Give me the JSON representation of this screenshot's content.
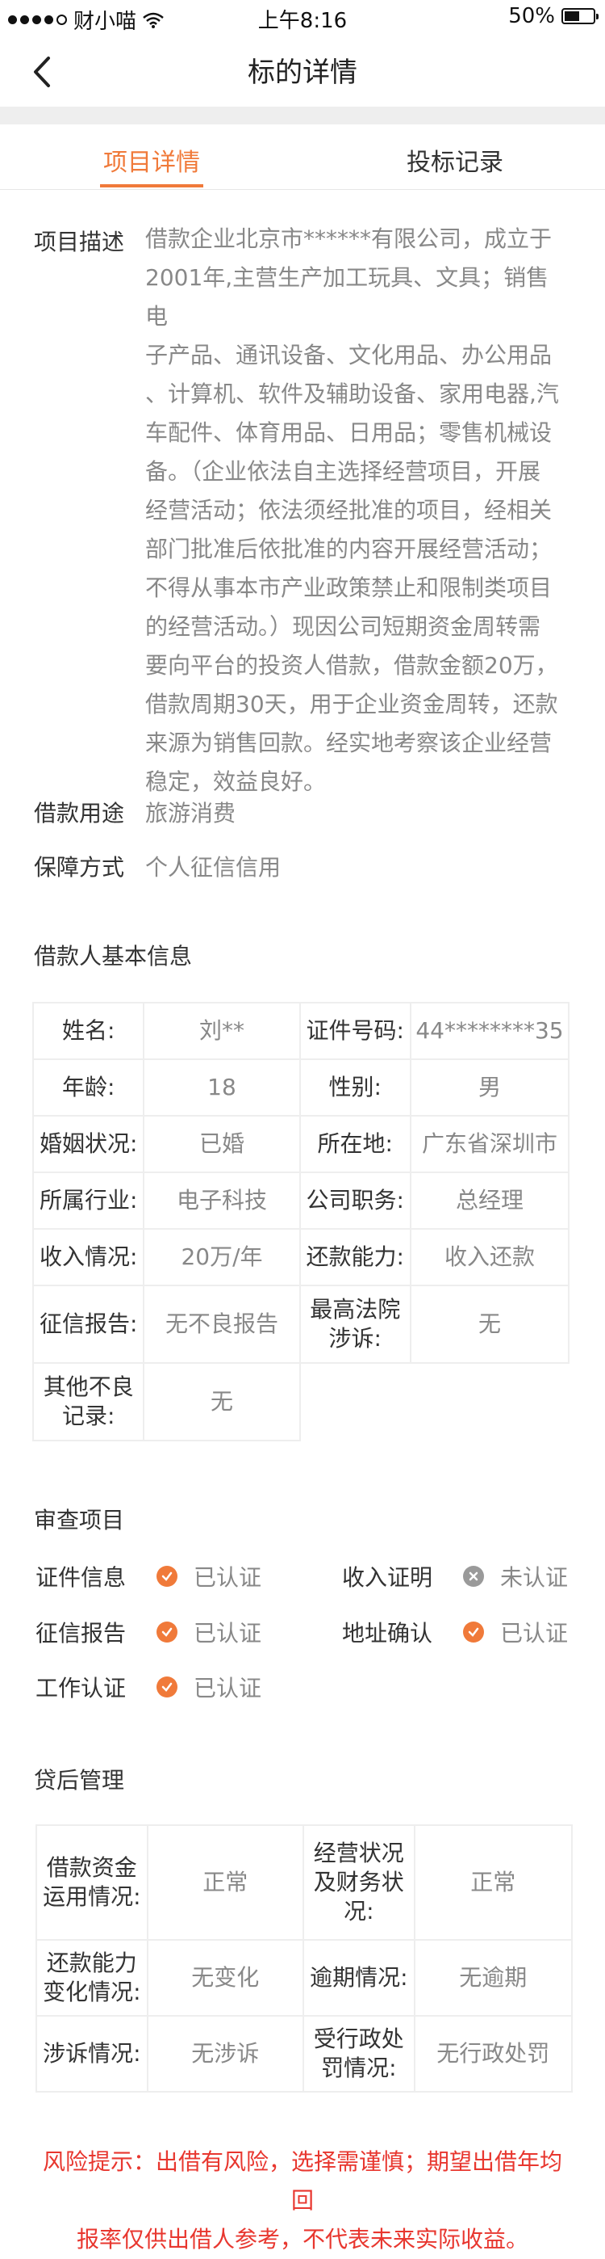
{
  "status": {
    "carrier": "财小喵",
    "time": "上午8:16",
    "battery": "50%"
  },
  "nav": {
    "title": "标的详情"
  },
  "tabs": [
    {
      "label": "项目详情",
      "active": true
    },
    {
      "label": "投标记录",
      "active": false
    }
  ],
  "project": {
    "desc_label": "项目描述",
    "desc_lines": [
      "借款企业北京市******有限公司，成立于",
      "2001年,主营生产加工玩具、文具；销售电",
      "子产品、通讯设备、文化用品、办公用品",
      "、计算机、软件及辅助设备、家用电器,汽",
      "车配件、体育用品、日用品；零售机械设",
      "备。（企业依法自主选择经营项目，开展",
      "经营活动；依法须经批准的项目，经相关",
      "部门批准后依批准的内容开展经营活动；",
      "不得从事本市产业政策禁止和限制类项目",
      "的经营活动。）现因公司短期资金周转需",
      "要向平台的投资人借款，借款金额20万，",
      "借款周期30天，用于企业资金周转，还款",
      "来源为销售回款。经实地考察该企业经营",
      "稳定，效益良好。"
    ],
    "purpose_label": "借款用途",
    "purpose": "旅游消费",
    "guarantee_label": "保障方式",
    "guarantee": "个人征信信用"
  },
  "borrower": {
    "title": "借款人基本信息",
    "rows": [
      [
        "姓名:",
        "刘**",
        "证件号码:",
        "44********35"
      ],
      [
        "年龄:",
        "18",
        "性别:",
        "男"
      ],
      [
        "婚姻状况:",
        "已婚",
        "所在地:",
        "广东省深圳市"
      ],
      [
        "所属行业:",
        "电子科技",
        "公司职务:",
        "总经理"
      ],
      [
        "收入情况:",
        "20万/年",
        "还款能力:",
        "收入还款"
      ],
      [
        "征信报告:",
        "无不良报告",
        "最高法院涉诉:",
        "无"
      ],
      [
        "其他不良记录:",
        "无"
      ]
    ]
  },
  "review": {
    "title": "审查项目",
    "items": [
      {
        "label": "证件信息",
        "status": "已认证",
        "ok": true
      },
      {
        "label": "收入证明",
        "status": "未认证",
        "ok": false
      },
      {
        "label": "征信报告",
        "status": "已认证",
        "ok": true
      },
      {
        "label": "地址确认",
        "status": "已认证",
        "ok": true
      },
      {
        "label": "工作认证",
        "status": "已认证",
        "ok": true
      }
    ]
  },
  "post_loan": {
    "title": "贷后管理",
    "rows": [
      [
        "借款资金运用情况:",
        "正常",
        "经营状况及财务状况:",
        "正常"
      ],
      [
        "还款能力变化情况:",
        "无变化",
        "逾期情况:",
        "无逾期"
      ],
      [
        "涉诉情况:",
        "无涉诉",
        "受行政处罚情况:",
        "无行政处罚"
      ]
    ]
  },
  "risk": {
    "line1": "风险提示：出借有风险，选择需谨慎；期望出借年均回",
    "line2": "报率仅供出借人参考，不代表未来实际收益。"
  },
  "colors": {
    "accent": "#f07a3a",
    "risk": "#e8372f",
    "muted": "#888888"
  }
}
